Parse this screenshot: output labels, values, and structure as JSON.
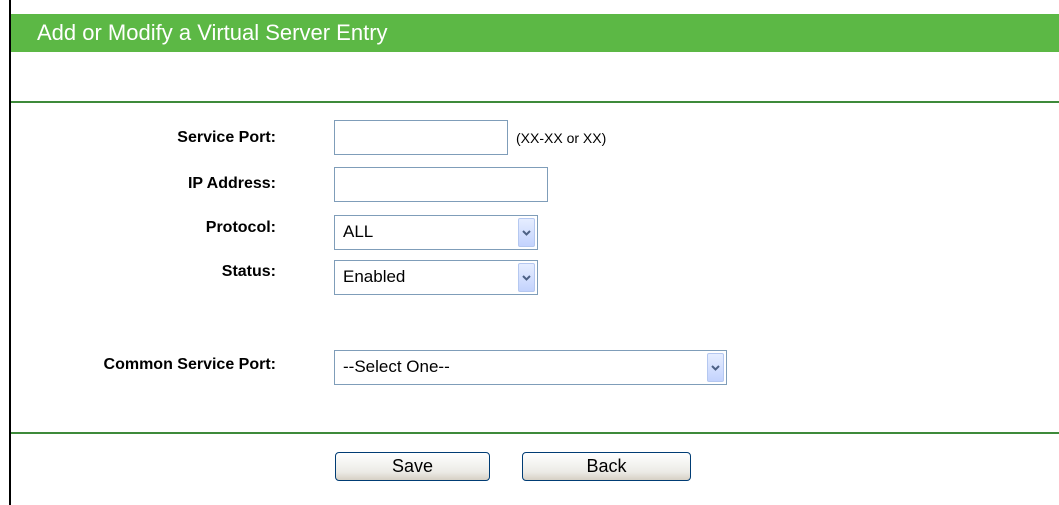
{
  "header": {
    "title": "Add or Modify a Virtual Server Entry"
  },
  "form": {
    "service_port": {
      "label": "Service Port:",
      "value": "",
      "hint": "(XX-XX or XX)"
    },
    "ip_address": {
      "label": "IP Address:",
      "value": ""
    },
    "protocol": {
      "label": "Protocol:",
      "selected": "ALL"
    },
    "status": {
      "label": "Status:",
      "selected": "Enabled"
    },
    "common_service_port": {
      "label": "Common Service Port:",
      "selected": "--Select One--"
    }
  },
  "buttons": {
    "save": "Save",
    "back": "Back"
  },
  "colors": {
    "header_bg": "#5cb845",
    "divider": "#3d8a3a",
    "header_text": "#ffffff"
  },
  "icons": {
    "dropdown": "chevron-down-icon"
  }
}
